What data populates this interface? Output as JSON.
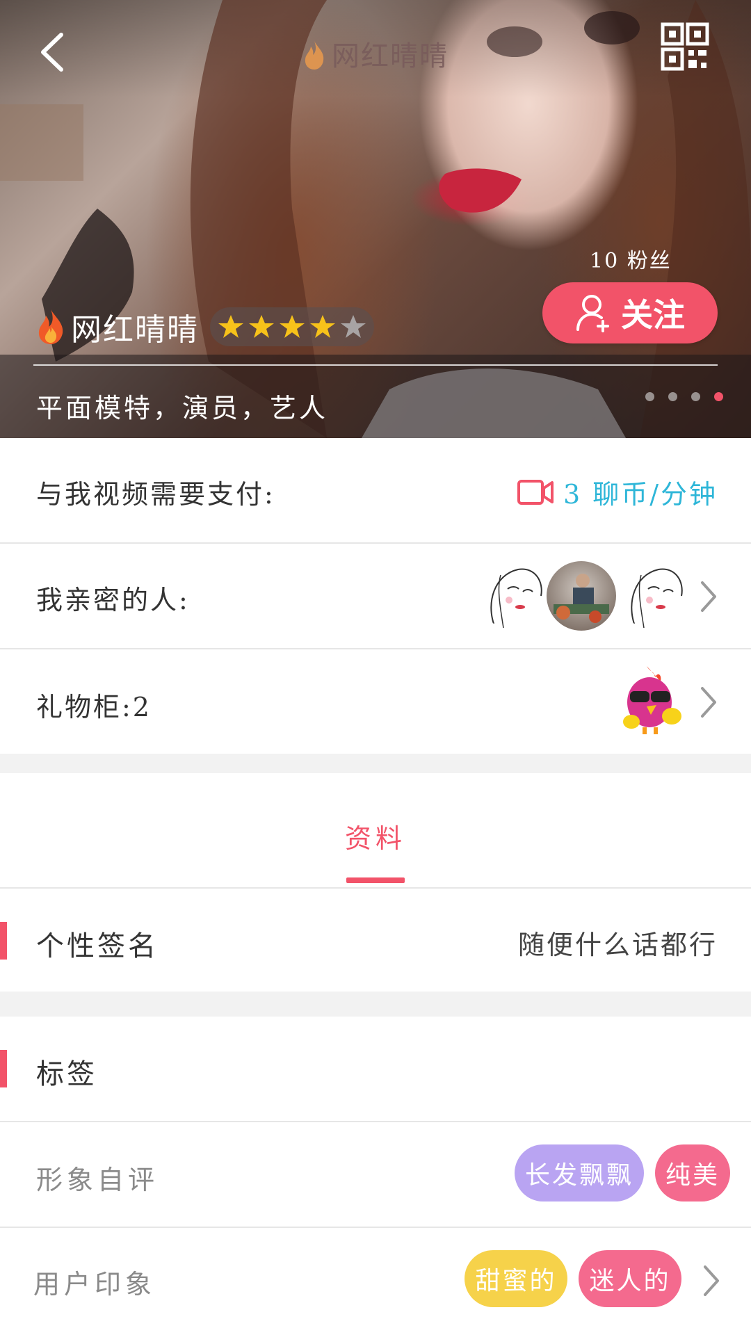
{
  "header": {
    "title": "网红晴晴",
    "back_icon": "back-arrow-icon",
    "qr_icon": "qr-code-icon"
  },
  "profile": {
    "name": "网红晴晴",
    "fans": "10 粉丝",
    "follow_label": "关注",
    "rating": 4,
    "rating_max": 5,
    "profession": "平面模特，演员，艺人",
    "carousel_pages": 4,
    "carousel_active": 4
  },
  "video_price": {
    "label": "与我视频需要支付:",
    "value": "3 聊币/分钟"
  },
  "intimate": {
    "label": "我亲密的人:"
  },
  "gift_cabinet": {
    "label": "礼物柜:2"
  },
  "tabs": [
    {
      "label": "资料",
      "active": true
    }
  ],
  "signature": {
    "title": "个性签名",
    "value": "随便什么话都行"
  },
  "tags_section": {
    "title": "标签",
    "self_eval": {
      "label": "形象自评",
      "tags": [
        {
          "text": "长发飘飘",
          "color": "#b9a4f2"
        },
        {
          "text": "纯美",
          "color": "#f46a8e"
        }
      ]
    },
    "user_impression": {
      "label": "用户印象",
      "tags": [
        {
          "text": "甜蜜的",
          "color": "#f6d24a"
        },
        {
          "text": "迷人的",
          "color": "#f46a8e"
        }
      ]
    }
  },
  "colors": {
    "accent": "#f25369",
    "price": "#2eb6d8"
  }
}
